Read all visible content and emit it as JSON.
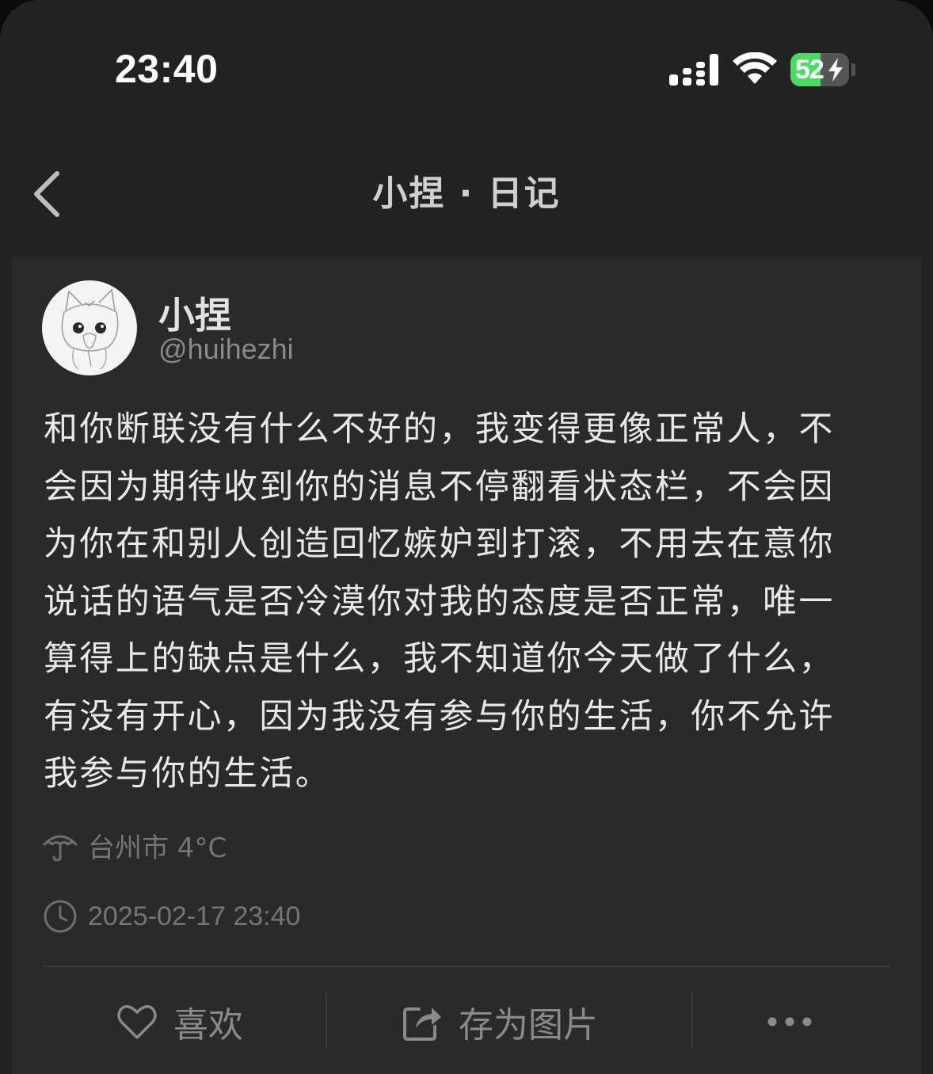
{
  "status_bar": {
    "time": "23:40",
    "battery_text": "52",
    "battery_level": 0.52,
    "signal_icon": "signal-bars-icon",
    "wifi_icon": "wifi-icon",
    "charging_icon": "bolt-icon"
  },
  "nav": {
    "title": "小捏 · 日记",
    "back_icon": "chevron-left-icon"
  },
  "post": {
    "user_name": "小捏",
    "user_handle": "@huihezhi",
    "content": "和你断联没有什么不好的，我变得更像正常人，不会因为期待收到你的消息不停翻看状态栏，不会因为你在和别人创造回忆嫉妒到打滚，不用去在意你说话的语气是否冷漠你对我的态度是否正常，唯一算得上的缺点是什么，我不知道你今天做了什么，有没有开心，因为我没有参与你的生活，你不允许我参与你的生活。",
    "location": "台州市 4°C",
    "location_icon": "umbrella-icon",
    "datetime": "2025-02-17 23:40",
    "datetime_icon": "clock-icon"
  },
  "actions": {
    "like_label": "喜欢",
    "like_icon": "heart-icon",
    "save_label": "存为图片",
    "save_icon": "share-icon",
    "more_icon": "more-icon"
  },
  "colors": {
    "background": "#222222",
    "card": "#2a2a2a",
    "text": "#e8e8e8",
    "muted": "#767676",
    "battery_green": "#4cd964"
  }
}
